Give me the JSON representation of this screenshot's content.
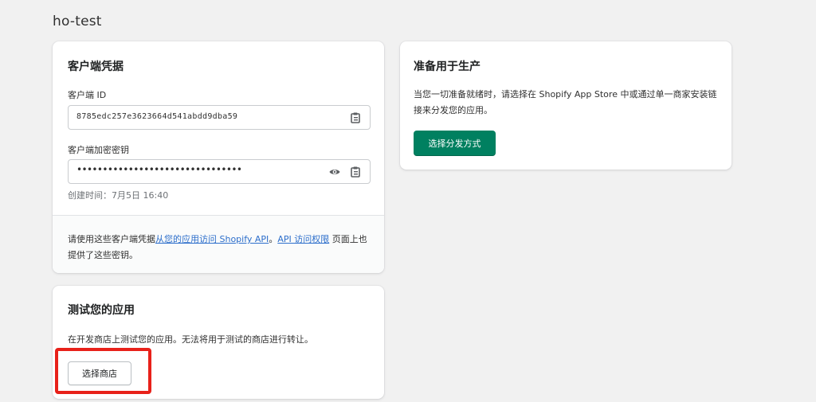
{
  "app": {
    "title": "ho-test"
  },
  "credentials_card": {
    "title": "客户端凭据",
    "client_id_label": "客户端 ID",
    "client_id_value": "8785edc257e3623664d541abdd9dba59",
    "client_secret_label": "客户端加密密钥",
    "client_secret_masked": "••••••••••••••••••••••••••••••••",
    "created": "创建时间：7月5日 16:40",
    "notice_prefix": "请使用这些客户端凭据",
    "notice_link1": "从您的应用访问 Shopify API",
    "notice_sep": "。",
    "notice_link2": "API 访问权限",
    "notice_suffix": " 页面上也提供了这些密钥。"
  },
  "test_card": {
    "title": "测试您的应用",
    "description": "在开发商店上测试您的应用。无法将用于测试的商店进行转让。",
    "select_store_button": "选择商店"
  },
  "production_card": {
    "title": "准备用于生产",
    "description": "当您一切准备就绪时，请选择在 Shopify App Store 中或通过单一商家安装链接来分发您的应用。",
    "select_distribution_button": "选择分发方式"
  },
  "colors": {
    "primary": "#008060",
    "link": "#2c6ecb",
    "highlight": "#e8211a",
    "background": "#f1f1f1"
  },
  "icons": {
    "copy": "clipboard-icon",
    "reveal": "eye-icon"
  }
}
